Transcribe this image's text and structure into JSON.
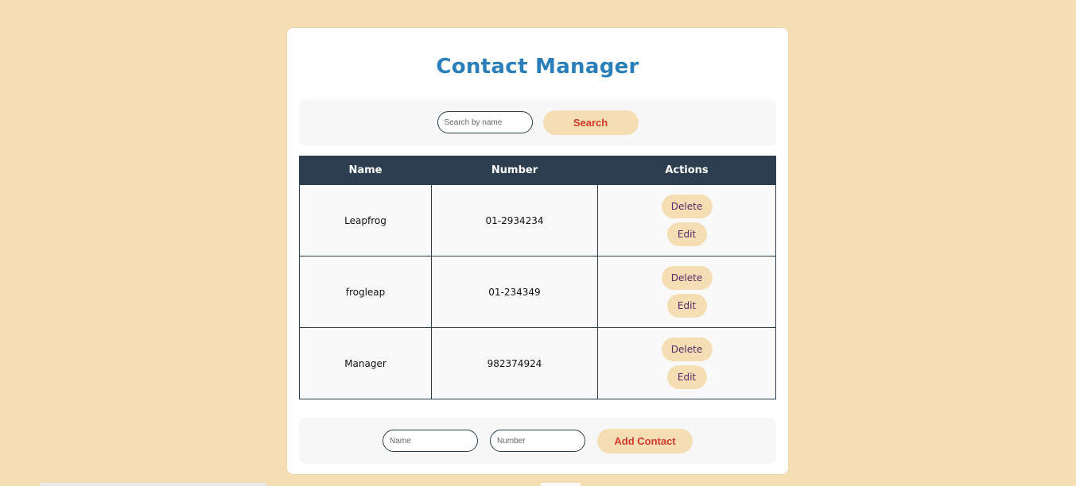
{
  "app": {
    "title": "Contact Manager"
  },
  "search": {
    "placeholder": "Search by name",
    "value": "",
    "button_label": "Search"
  },
  "table": {
    "headers": [
      "Name",
      "Number",
      "Actions"
    ],
    "rows": [
      {
        "name": "Leapfrog",
        "number": "01-2934234",
        "delete_label": "Delete",
        "edit_label": "Edit"
      },
      {
        "name": "frogleap",
        "number": "01-234349",
        "delete_label": "Delete",
        "edit_label": "Edit"
      },
      {
        "name": "Manager",
        "number": "982374924",
        "delete_label": "Delete",
        "edit_label": "Edit"
      }
    ]
  },
  "add_form": {
    "name_placeholder": "Name",
    "number_placeholder": "Number",
    "button_label": "Add Contact"
  },
  "colors": {
    "background": "#f5deb3",
    "title": "#2a7fba",
    "table_header": "#2c3e50",
    "button_bg": "#f5deb3",
    "primary_button_text": "#d03a2a",
    "row_button_text": "#5a2a6a"
  }
}
